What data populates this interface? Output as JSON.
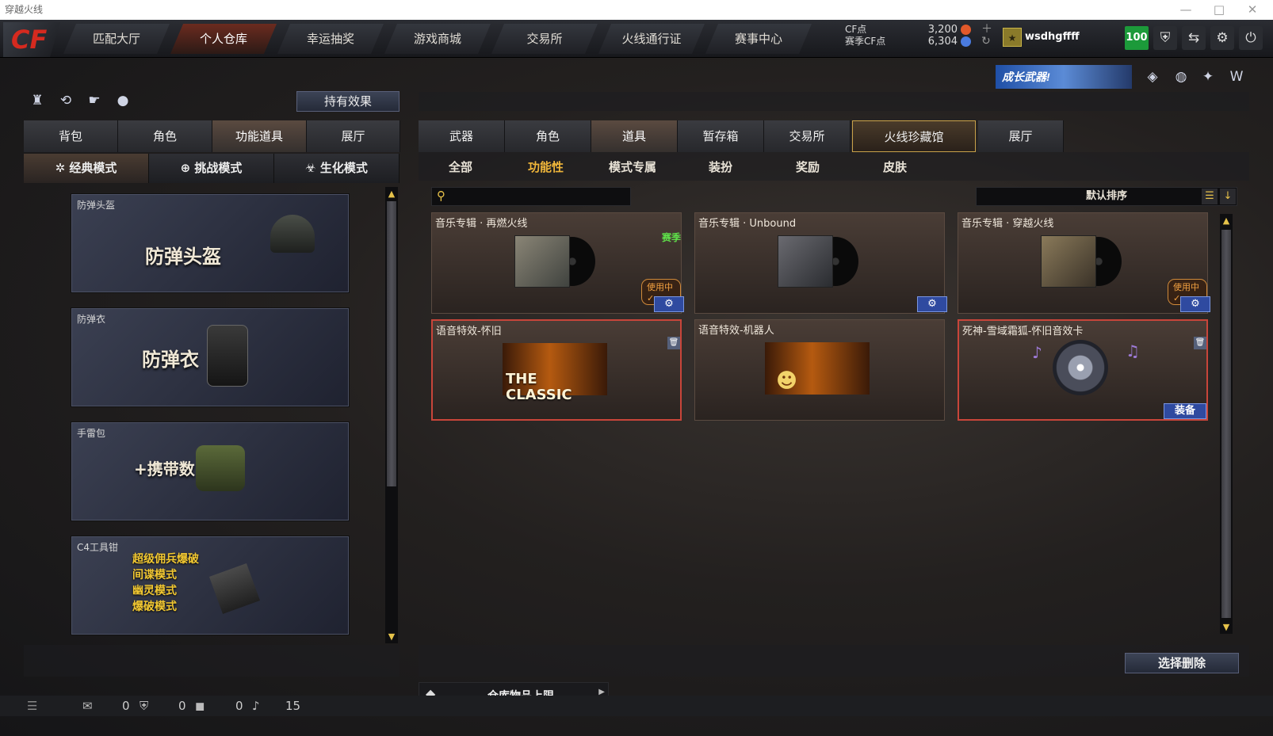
{
  "window": {
    "title": "穿越火线",
    "min": "—",
    "max": "□",
    "close": "✕"
  },
  "logo": "CF",
  "nav": {
    "tabs": [
      "匹配大厅",
      "个人仓库",
      "幸运抽奖",
      "游戏商城",
      "交易所",
      "火线通行证",
      "赛事中心"
    ],
    "active": 1
  },
  "currency": {
    "cf_label": "CF点",
    "cf_value": "3,200",
    "season_label": "赛季CF点",
    "season_value": "6,304"
  },
  "user": {
    "name": "wsdhgffff",
    "level": "100"
  },
  "promo": "成长武器!",
  "left": {
    "effects_button": "持有效果",
    "tabs": [
      "背包",
      "角色",
      "功能道具",
      "展厅"
    ],
    "active_tab": 2,
    "modes": [
      "经典模式",
      "挑战模式",
      "生化模式"
    ],
    "active_mode": 0,
    "cards": [
      {
        "label": "防弹头盔",
        "big": "防弹头盔"
      },
      {
        "label": "防弹衣",
        "big": "防弹衣"
      },
      {
        "label": "手雷包",
        "big": "+携带数"
      },
      {
        "label": "C4工具钳",
        "lines": [
          "超级佣兵爆破",
          "间谍模式",
          "幽灵模式",
          "爆破模式"
        ]
      }
    ]
  },
  "right": {
    "tabs": [
      "武器",
      "角色",
      "道具",
      "暂存箱",
      "交易所",
      "火线珍藏馆",
      "展厅"
    ],
    "active_tab": 2,
    "highlight_tab": 5,
    "filters": [
      "全部",
      "功能性",
      "模式专属",
      "装扮",
      "奖励",
      "皮肤"
    ],
    "active_filter": 1,
    "search_placeholder": "",
    "sort": "默认排序",
    "items": [
      {
        "title": "音乐专辑 · 再燃火线",
        "tag": "赛季",
        "status": "使用中✓",
        "type": "album"
      },
      {
        "title": "音乐专辑 · Unbound",
        "type": "album"
      },
      {
        "title": "音乐专辑 · 穿越火线",
        "status": "使用中✓",
        "type": "album"
      },
      {
        "title": "语音特效-怀旧",
        "overlay": "THE CLASSIC",
        "type": "voice"
      },
      {
        "title": "语音特效-机器人",
        "type": "voice"
      },
      {
        "title": "死神-雪域霜狐-怀旧音效卡",
        "action": "装备",
        "type": "cd"
      }
    ],
    "delete_button": "选择删除",
    "capacity_label": "仓库物品上限"
  },
  "statusbar": {
    "c1": "0",
    "c2": "0",
    "c3": "0",
    "c4": "15"
  }
}
